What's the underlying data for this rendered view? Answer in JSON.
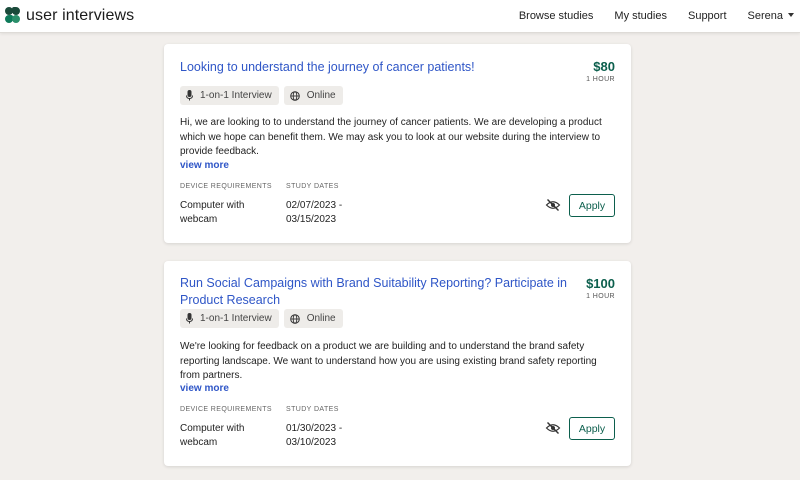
{
  "header": {
    "logo_text": "user interviews",
    "nav": [
      "Browse studies",
      "My studies",
      "Support",
      "Serena"
    ]
  },
  "labels": {
    "device_requirements": "DEVICE REQUIREMENTS",
    "study_dates": "STUDY DATES",
    "view_more": "view more",
    "apply": "Apply",
    "per_hour": "1 HOUR"
  },
  "studies": [
    {
      "title": "Looking to understand the journey of cancer patients!",
      "price": "$80",
      "duration": "1 HOUR",
      "tags": [
        "1-on-1 Interview",
        "Online"
      ],
      "description": "Hi, we are looking to to understand the journey of cancer patients. We are developing a product which we hope can benefit them. We may ask you to look at our website during the interview to provide feedback.",
      "device": "Computer with webcam",
      "dates": "02/07/2023 - 03/15/2023"
    },
    {
      "title": "Run Social Campaigns with Brand Suitability Reporting? Participate in Product Research",
      "price": "$100",
      "duration": "1 HOUR",
      "tags": [
        "1-on-1 Interview",
        "Online"
      ],
      "description": "We're looking for feedback on a product we are building and to understand the brand safety reporting landscape. We want to understand how you are using existing brand safety reporting from partners.",
      "device": "Computer with webcam",
      "dates": "01/30/2023 - 03/10/2023"
    }
  ],
  "colors": {
    "brand_green": "#0c5f4d",
    "link_blue": "#2f56c7",
    "background": "#f2efec"
  },
  "icons": [
    "microphone-icon",
    "globe-icon",
    "eye-slash-icon",
    "chevron-down-icon"
  ]
}
